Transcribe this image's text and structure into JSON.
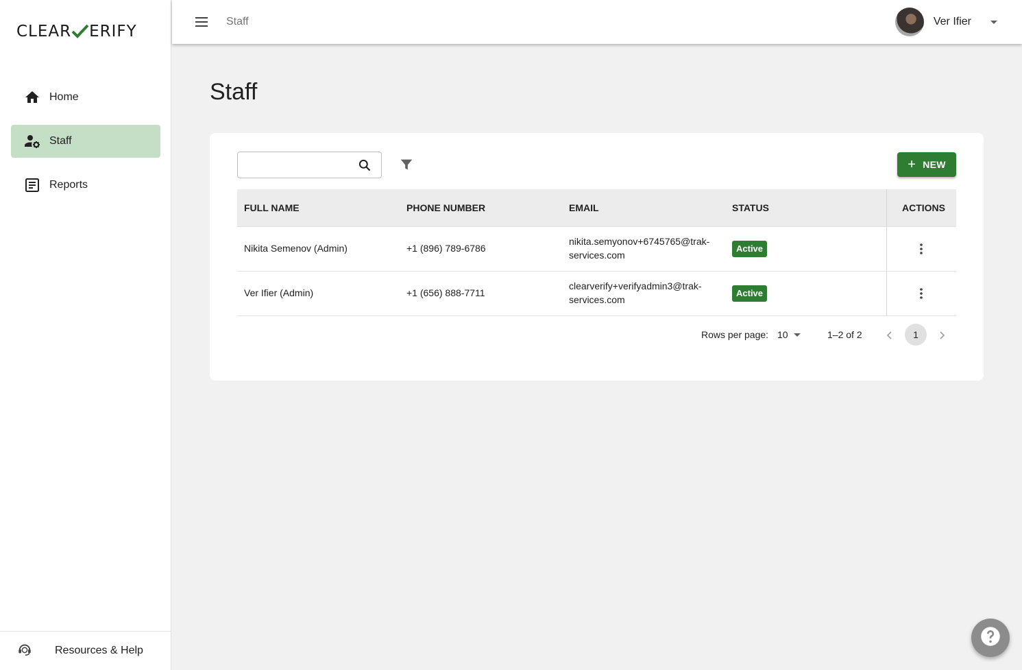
{
  "app": {
    "logo_left": "CLEAR",
    "logo_right": "ERIFY",
    "brand_color": "#2e7d32"
  },
  "sidebar": {
    "items": [
      {
        "label": "Home",
        "icon": "home-icon",
        "active": false
      },
      {
        "label": "Staff",
        "icon": "staff-settings-icon",
        "active": true
      },
      {
        "label": "Reports",
        "icon": "reports-icon",
        "active": false
      }
    ],
    "footer_label": "Resources & Help",
    "footer_icon": "support-agent-icon"
  },
  "header": {
    "breadcrumb": "Staff",
    "user_name": "Ver Ifier"
  },
  "main": {
    "title": "Staff",
    "search_placeholder": "",
    "new_button_label": "NEW",
    "table": {
      "columns": [
        "FULL NAME",
        "PHONE NUMBER",
        "EMAIL",
        "STATUS",
        "ACTIONS"
      ],
      "rows": [
        {
          "full_name": "Nikita Semenov (Admin)",
          "phone": "+1 (896) 789-6786",
          "email_line1": "nikita.semyonov+6745765@trak-",
          "email_line2": "services.com",
          "status": "Active"
        },
        {
          "full_name": "Ver Ifier (Admin)",
          "phone": "+1 (656) 888-7711",
          "email_line1": "clearverify+verifyadmin3@trak-",
          "email_line2": "services.com",
          "status": "Active"
        }
      ]
    },
    "pagination": {
      "rows_per_page_label": "Rows per page:",
      "rows_per_page": "10",
      "range": "1–2 of 2",
      "current_page": "1"
    }
  }
}
